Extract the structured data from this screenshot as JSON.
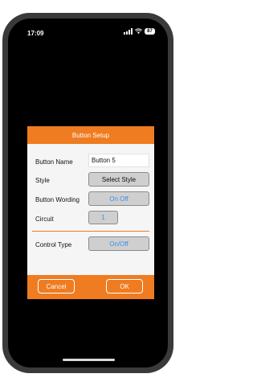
{
  "status_bar": {
    "time": "17:09",
    "battery": "87"
  },
  "dialog": {
    "title": "Button Setup",
    "rows": {
      "button_name": {
        "label": "Button Name",
        "value": "Button 5"
      },
      "style": {
        "label": "Style",
        "button": "Select Style"
      },
      "button_wording": {
        "label": "Button Wording",
        "button": "On Off"
      },
      "circuit": {
        "label": "Circuit",
        "value": "1"
      },
      "control_type": {
        "label": "Control Type",
        "button": "On/Off"
      }
    },
    "cancel_label": "Cancel",
    "ok_label": "OK"
  },
  "colors": {
    "accent": "#ef7c21",
    "link_blue": "#3d8ee9",
    "button_gray": "#cfcfcf"
  }
}
